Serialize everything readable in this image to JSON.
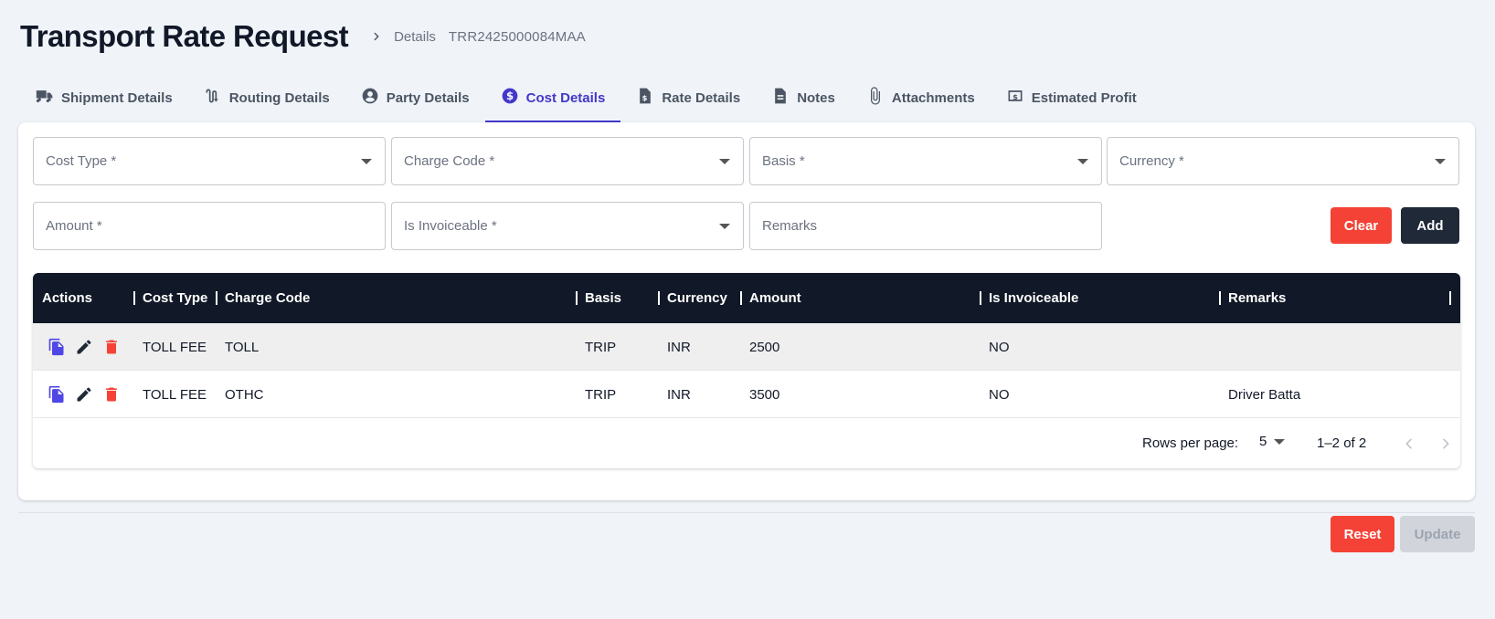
{
  "header": {
    "title": "Transport Rate Request",
    "breadcrumb_label": "Details",
    "breadcrumb_id": "TRR2425000084MAA"
  },
  "tabs": [
    {
      "label": "Shipment Details",
      "icon": "truck-icon"
    },
    {
      "label": "Routing Details",
      "icon": "route-icon"
    },
    {
      "label": "Party Details",
      "icon": "account-circle-icon"
    },
    {
      "label": "Cost Details",
      "icon": "dollar-circle-icon",
      "active": true
    },
    {
      "label": "Rate Details",
      "icon": "invoice-document-icon"
    },
    {
      "label": "Notes",
      "icon": "notes-document-icon"
    },
    {
      "label": "Attachments",
      "icon": "paperclip-icon"
    },
    {
      "label": "Estimated Profit",
      "icon": "money-bill-icon"
    }
  ],
  "form": {
    "cost_type": "Cost Type *",
    "charge_code": "Charge Code *",
    "basis": "Basis *",
    "currency": "Currency *",
    "amount": "Amount *",
    "is_invoiceable": "Is Invoiceable *",
    "remarks": "Remarks",
    "clear_label": "Clear",
    "add_label": "Add"
  },
  "table": {
    "columns": [
      "Actions",
      "Cost Type",
      "Charge Code",
      "Basis",
      "Currency",
      "Amount",
      "Is Invoiceable",
      "Remarks"
    ],
    "rows": [
      {
        "cost_type": "TOLL FEE",
        "charge_code": "TOLL",
        "basis": "TRIP",
        "currency": "INR",
        "amount": "2500",
        "is_invoiceable": "NO",
        "remarks": ""
      },
      {
        "cost_type": "TOLL FEE",
        "charge_code": "OTHC",
        "basis": "TRIP",
        "currency": "INR",
        "amount": "3500",
        "is_invoiceable": "NO",
        "remarks": "Driver Batta"
      }
    ],
    "pagination": {
      "rows_per_page_label": "Rows per page:",
      "rows_per_page": "5",
      "range": "1–2 of 2"
    }
  },
  "footer": {
    "reset_label": "Reset",
    "update_label": "Update"
  },
  "colors": {
    "accent": "#4338ca",
    "header_dark": "#111827",
    "danger": "#f44336",
    "copy_icon": "#4f46e5"
  }
}
